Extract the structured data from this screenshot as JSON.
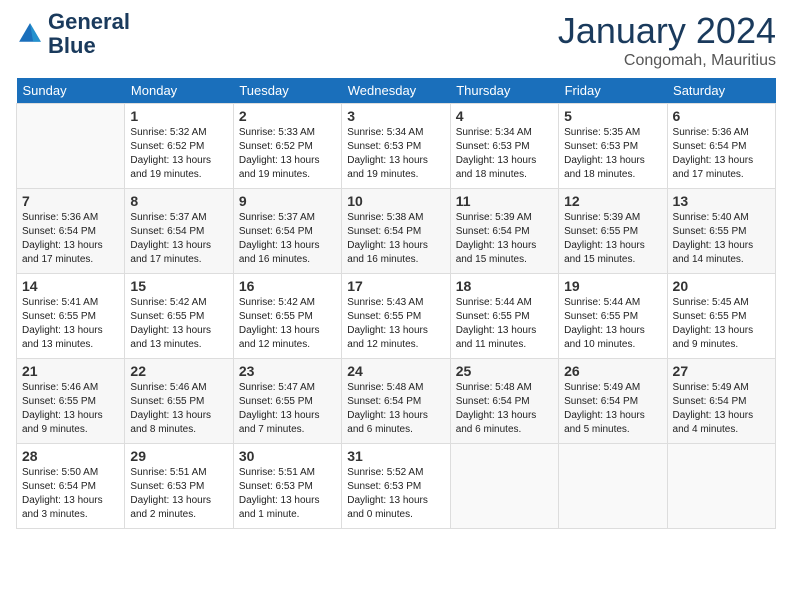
{
  "header": {
    "logo_line1": "General",
    "logo_line2": "Blue",
    "month_title": "January 2024",
    "location": "Congomah, Mauritius"
  },
  "days_of_week": [
    "Sunday",
    "Monday",
    "Tuesday",
    "Wednesday",
    "Thursday",
    "Friday",
    "Saturday"
  ],
  "weeks": [
    [
      {
        "num": "",
        "empty": true
      },
      {
        "num": "1",
        "sunrise": "5:32 AM",
        "sunset": "6:52 PM",
        "daylight": "13 hours and 19 minutes."
      },
      {
        "num": "2",
        "sunrise": "5:33 AM",
        "sunset": "6:52 PM",
        "daylight": "13 hours and 19 minutes."
      },
      {
        "num": "3",
        "sunrise": "5:34 AM",
        "sunset": "6:53 PM",
        "daylight": "13 hours and 19 minutes."
      },
      {
        "num": "4",
        "sunrise": "5:34 AM",
        "sunset": "6:53 PM",
        "daylight": "13 hours and 18 minutes."
      },
      {
        "num": "5",
        "sunrise": "5:35 AM",
        "sunset": "6:53 PM",
        "daylight": "13 hours and 18 minutes."
      },
      {
        "num": "6",
        "sunrise": "5:36 AM",
        "sunset": "6:54 PM",
        "daylight": "13 hours and 17 minutes."
      }
    ],
    [
      {
        "num": "7",
        "sunrise": "5:36 AM",
        "sunset": "6:54 PM",
        "daylight": "13 hours and 17 minutes."
      },
      {
        "num": "8",
        "sunrise": "5:37 AM",
        "sunset": "6:54 PM",
        "daylight": "13 hours and 17 minutes."
      },
      {
        "num": "9",
        "sunrise": "5:37 AM",
        "sunset": "6:54 PM",
        "daylight": "13 hours and 16 minutes."
      },
      {
        "num": "10",
        "sunrise": "5:38 AM",
        "sunset": "6:54 PM",
        "daylight": "13 hours and 16 minutes."
      },
      {
        "num": "11",
        "sunrise": "5:39 AM",
        "sunset": "6:54 PM",
        "daylight": "13 hours and 15 minutes."
      },
      {
        "num": "12",
        "sunrise": "5:39 AM",
        "sunset": "6:55 PM",
        "daylight": "13 hours and 15 minutes."
      },
      {
        "num": "13",
        "sunrise": "5:40 AM",
        "sunset": "6:55 PM",
        "daylight": "13 hours and 14 minutes."
      }
    ],
    [
      {
        "num": "14",
        "sunrise": "5:41 AM",
        "sunset": "6:55 PM",
        "daylight": "13 hours and 13 minutes."
      },
      {
        "num": "15",
        "sunrise": "5:42 AM",
        "sunset": "6:55 PM",
        "daylight": "13 hours and 13 minutes."
      },
      {
        "num": "16",
        "sunrise": "5:42 AM",
        "sunset": "6:55 PM",
        "daylight": "13 hours and 12 minutes."
      },
      {
        "num": "17",
        "sunrise": "5:43 AM",
        "sunset": "6:55 PM",
        "daylight": "13 hours and 12 minutes."
      },
      {
        "num": "18",
        "sunrise": "5:44 AM",
        "sunset": "6:55 PM",
        "daylight": "13 hours and 11 minutes."
      },
      {
        "num": "19",
        "sunrise": "5:44 AM",
        "sunset": "6:55 PM",
        "daylight": "13 hours and 10 minutes."
      },
      {
        "num": "20",
        "sunrise": "5:45 AM",
        "sunset": "6:55 PM",
        "daylight": "13 hours and 9 minutes."
      }
    ],
    [
      {
        "num": "21",
        "sunrise": "5:46 AM",
        "sunset": "6:55 PM",
        "daylight": "13 hours and 9 minutes."
      },
      {
        "num": "22",
        "sunrise": "5:46 AM",
        "sunset": "6:55 PM",
        "daylight": "13 hours and 8 minutes."
      },
      {
        "num": "23",
        "sunrise": "5:47 AM",
        "sunset": "6:55 PM",
        "daylight": "13 hours and 7 minutes."
      },
      {
        "num": "24",
        "sunrise": "5:48 AM",
        "sunset": "6:54 PM",
        "daylight": "13 hours and 6 minutes."
      },
      {
        "num": "25",
        "sunrise": "5:48 AM",
        "sunset": "6:54 PM",
        "daylight": "13 hours and 6 minutes."
      },
      {
        "num": "26",
        "sunrise": "5:49 AM",
        "sunset": "6:54 PM",
        "daylight": "13 hours and 5 minutes."
      },
      {
        "num": "27",
        "sunrise": "5:49 AM",
        "sunset": "6:54 PM",
        "daylight": "13 hours and 4 minutes."
      }
    ],
    [
      {
        "num": "28",
        "sunrise": "5:50 AM",
        "sunset": "6:54 PM",
        "daylight": "13 hours and 3 minutes."
      },
      {
        "num": "29",
        "sunrise": "5:51 AM",
        "sunset": "6:53 PM",
        "daylight": "13 hours and 2 minutes."
      },
      {
        "num": "30",
        "sunrise": "5:51 AM",
        "sunset": "6:53 PM",
        "daylight": "13 hours and 1 minute."
      },
      {
        "num": "31",
        "sunrise": "5:52 AM",
        "sunset": "6:53 PM",
        "daylight": "13 hours and 0 minutes."
      },
      {
        "num": "",
        "empty": true
      },
      {
        "num": "",
        "empty": true
      },
      {
        "num": "",
        "empty": true
      }
    ]
  ]
}
